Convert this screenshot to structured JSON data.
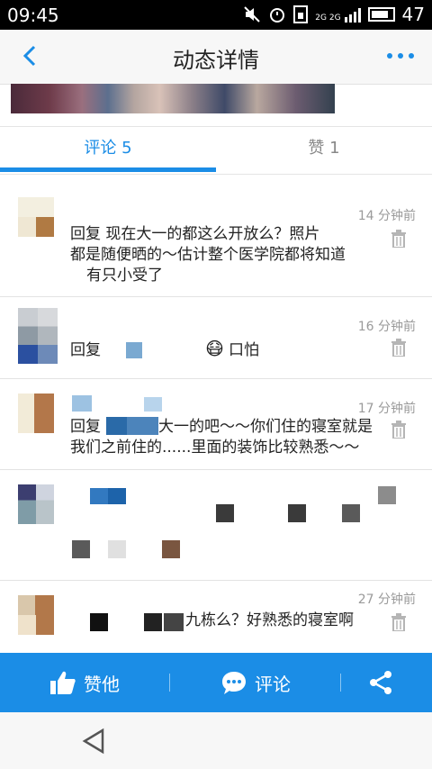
{
  "statusbar": {
    "time": "09:45",
    "battery": "47",
    "signal_labels": "2G 2G"
  },
  "header": {
    "title": "动态详情"
  },
  "tabs": {
    "comments": "评论 5",
    "likes": "赞 1"
  },
  "comments": [
    {
      "time": "14 分钟前",
      "lines": [
        "回复 现在大一的都这么开放么？照片",
        "都是随便晒的～估计整个医学院都将知道",
        "有只小受了"
      ]
    },
    {
      "time": "16 分钟前",
      "lines": [
        "回复",
        "口怕"
      ]
    },
    {
      "time": "17 分钟前",
      "lines": [
        "回复",
        "大一的吧～～你们住的寝室就是",
        "我们之前住的......里面的装饰比较熟悉～～"
      ]
    },
    {
      "time": "",
      "lines": []
    },
    {
      "time": "27 分钟前",
      "lines": [
        "九栋么？好熟悉的寝室啊"
      ]
    }
  ],
  "actions": {
    "like": "赞他",
    "comment": "评论"
  },
  "colors": {
    "accent": "#1b8de6"
  }
}
